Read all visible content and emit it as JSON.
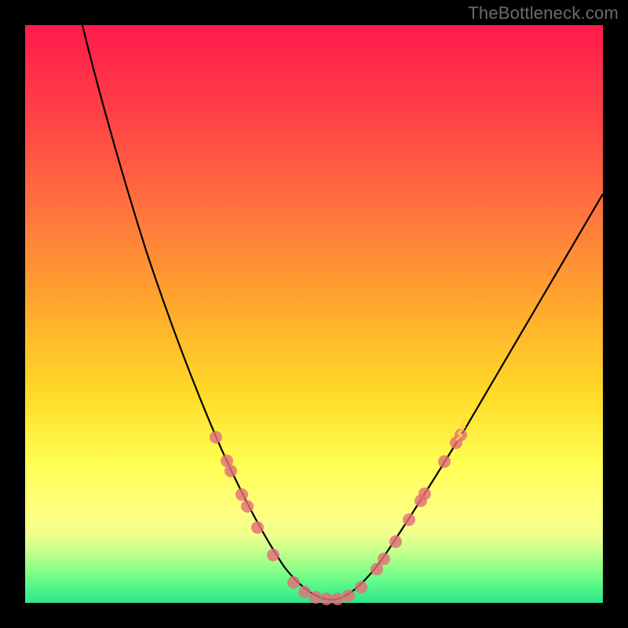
{
  "watermark": "TheBottleneck.com",
  "chart_data": {
    "type": "line",
    "title": "",
    "xlabel": "",
    "ylabel": "",
    "xlim": [
      0,
      100
    ],
    "ylim": [
      0,
      100
    ],
    "grid": false,
    "series": [
      {
        "name": "curve",
        "x": [
          10,
          12,
          15,
          18,
          21,
          24,
          27,
          30,
          33,
          36,
          38,
          40,
          42,
          44,
          46,
          48,
          50,
          52,
          55,
          58,
          62,
          66,
          70,
          75,
          80,
          86,
          92,
          100
        ],
        "y": [
          100,
          90,
          78,
          67,
          57,
          48,
          40,
          33,
          26,
          20,
          16,
          12,
          8,
          5,
          3,
          2,
          2,
          3,
          6,
          10,
          16,
          22,
          29,
          37,
          45,
          54,
          63,
          75
        ]
      }
    ],
    "annotations": {
      "dots_curve_indices": [
        8,
        9,
        10,
        11,
        12,
        13,
        14,
        15,
        16,
        17,
        18,
        19,
        20,
        21
      ],
      "curve_min_index": 15
    },
    "colors": {
      "background_top": "#ff1a4d",
      "background_bottom": "#2fe390",
      "curve": "#000000",
      "dots": "#e36f78"
    }
  }
}
